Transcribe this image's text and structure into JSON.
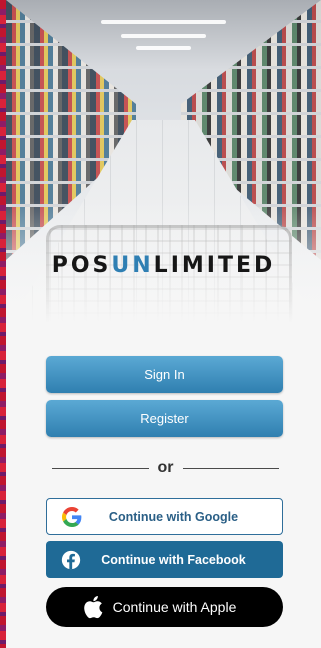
{
  "brand": {
    "logo_prefix": "POS",
    "logo_accent": "UN",
    "logo_suffix": "LIMITED",
    "accent_color": "#2f7fb3"
  },
  "hero": {
    "image": "supermarket-aisle-with-shopping-cart"
  },
  "auth": {
    "sign_in_label": "Sign In",
    "register_label": "Register",
    "divider_text": "or"
  },
  "social": {
    "google_label": "Continue with Google",
    "google_icon": "google-icon",
    "facebook_label": "Continue with Facebook",
    "facebook_icon": "facebook-icon",
    "apple_label": "Continue with Apple",
    "apple_icon": "apple-icon"
  }
}
